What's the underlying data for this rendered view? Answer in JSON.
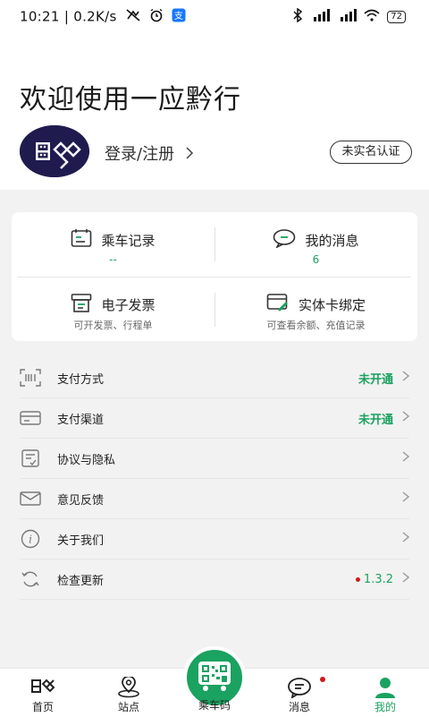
{
  "status_bar": {
    "time": "10:21",
    "speed": "| 0.2K/s",
    "battery": "72"
  },
  "header": {
    "welcome": "欢迎使用一应黔行",
    "login": "登录/注册",
    "realname_badge": "未实名认证"
  },
  "quick": {
    "ride_record": {
      "title": "乘车记录",
      "value": "--"
    },
    "messages": {
      "title": "我的消息",
      "value": "6"
    },
    "invoice": {
      "title": "电子发票",
      "sub": "可开发票、行程单"
    },
    "card_bind": {
      "title": "实体卡绑定",
      "sub": "可查看余额、充值记录"
    }
  },
  "menu": [
    {
      "icon": "payment-method-icon",
      "label": "支付方式",
      "status": "未开通"
    },
    {
      "icon": "payment-channel-icon",
      "label": "支付渠道",
      "status": "未开通"
    },
    {
      "icon": "agreement-icon",
      "label": "协议与隐私"
    },
    {
      "icon": "feedback-mail-icon",
      "label": "意见反馈"
    },
    {
      "icon": "info-icon",
      "label": "关于我们"
    },
    {
      "icon": "refresh-icon",
      "label": "检查更新",
      "version": "1.3.2"
    }
  ],
  "tabs": {
    "home": "首页",
    "stations": "站点",
    "ride_code": "乘车码",
    "messages": "消息",
    "mine": "我的"
  },
  "colors": {
    "accent": "#1aa260",
    "badge": "#d21a1a"
  }
}
